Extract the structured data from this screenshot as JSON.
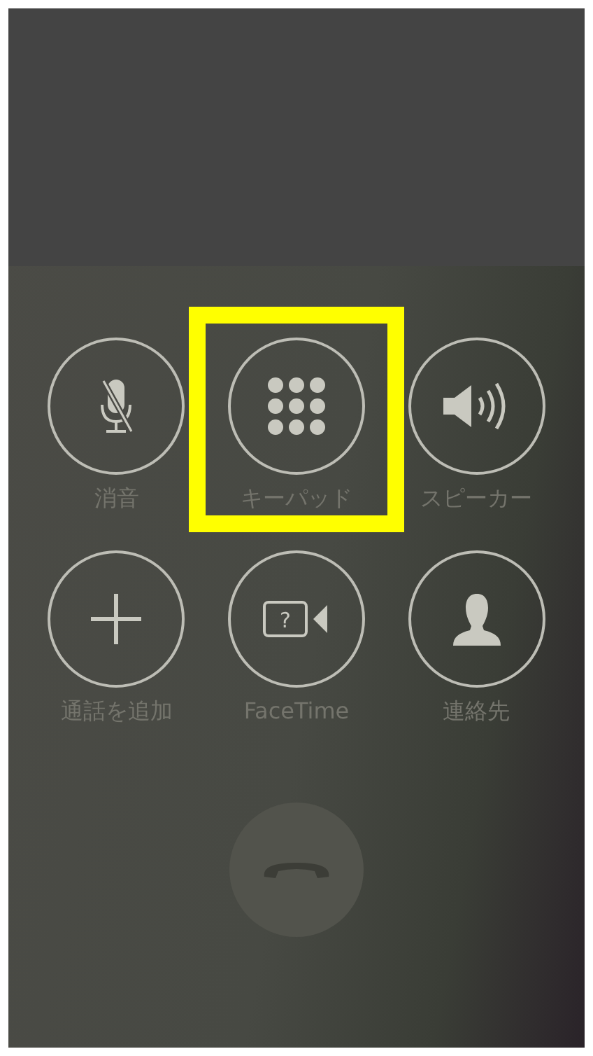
{
  "controls": [
    {
      "kind": "mute",
      "label": "消音",
      "highlighted": false
    },
    {
      "kind": "keypad",
      "label": "キーパッド",
      "highlighted": true
    },
    {
      "kind": "speaker",
      "label": "スピーカー",
      "highlighted": false
    },
    {
      "kind": "add",
      "label": "通話を追加",
      "highlighted": false
    },
    {
      "kind": "facetime",
      "label": "FaceTime",
      "glyph": "?",
      "highlighted": false
    },
    {
      "kind": "contacts",
      "label": "連絡先",
      "highlighted": false
    }
  ]
}
